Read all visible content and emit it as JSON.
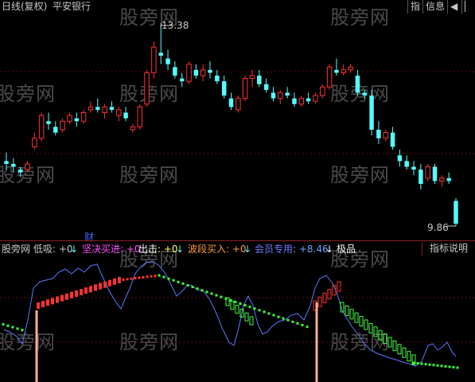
{
  "window": {
    "title_period": "日线(复权)",
    "stock_name": "平安银行",
    "btn_indicator": "指",
    "btn_info": "信息",
    "btn_back": "◀",
    "btn_last": "▏"
  },
  "price_chart": {
    "high_label": "13.38",
    "low_label": "9.86",
    "cai_label": "财",
    "up_color": "#ff3232",
    "down_color": "#54ffff",
    "candles": [
      [
        11.0,
        11.15,
        10.85,
        10.95
      ],
      [
        10.95,
        11.05,
        10.8,
        10.9
      ],
      [
        10.85,
        10.9,
        10.72,
        10.8
      ],
      [
        10.85,
        11.0,
        10.8,
        10.95
      ],
      [
        11.25,
        11.5,
        11.2,
        11.4
      ],
      [
        11.4,
        11.85,
        11.35,
        11.8
      ],
      [
        11.7,
        11.85,
        11.55,
        11.65
      ],
      [
        11.6,
        11.7,
        11.45,
        11.5
      ],
      [
        11.55,
        11.75,
        11.5,
        11.7
      ],
      [
        11.7,
        11.85,
        11.65,
        11.8
      ],
      [
        11.75,
        11.85,
        11.6,
        11.7
      ],
      [
        11.7,
        11.9,
        11.65,
        11.85
      ],
      [
        11.9,
        12.05,
        11.85,
        11.95
      ],
      [
        11.95,
        12.1,
        11.85,
        11.9
      ],
      [
        11.85,
        12.0,
        11.75,
        11.95
      ],
      [
        11.95,
        12.05,
        11.85,
        11.9
      ],
      [
        11.8,
        11.95,
        11.7,
        11.9
      ],
      [
        11.85,
        11.95,
        11.7,
        11.75
      ],
      [
        11.55,
        11.65,
        11.5,
        11.6
      ],
      [
        11.6,
        12.0,
        11.55,
        11.95
      ],
      [
        12.0,
        12.6,
        11.95,
        12.55
      ],
      [
        12.55,
        13.1,
        12.45,
        13.0
      ],
      [
        12.9,
        13.38,
        12.7,
        12.85
      ],
      [
        12.8,
        12.95,
        12.6,
        12.7
      ],
      [
        12.65,
        12.75,
        12.45,
        12.5
      ],
      [
        12.45,
        12.55,
        12.3,
        12.4
      ],
      [
        12.4,
        12.75,
        12.35,
        12.7
      ],
      [
        12.6,
        12.7,
        12.45,
        12.5
      ],
      [
        12.5,
        12.7,
        12.4,
        12.6
      ],
      [
        12.6,
        12.75,
        12.45,
        12.55
      ],
      [
        12.5,
        12.6,
        12.35,
        12.4
      ],
      [
        12.4,
        12.5,
        12.1,
        12.15
      ],
      [
        12.1,
        12.2,
        11.9,
        11.95
      ],
      [
        11.9,
        12.15,
        11.85,
        12.1
      ],
      [
        12.1,
        12.5,
        12.05,
        12.45
      ],
      [
        12.45,
        12.6,
        12.3,
        12.5
      ],
      [
        12.5,
        12.6,
        12.3,
        12.35
      ],
      [
        12.35,
        12.45,
        12.2,
        12.25
      ],
      [
        12.2,
        12.3,
        12.05,
        12.1
      ],
      [
        12.1,
        12.25,
        12.0,
        12.2
      ],
      [
        12.2,
        12.3,
        12.1,
        12.15
      ],
      [
        12.1,
        12.2,
        11.95,
        12.0
      ],
      [
        12.0,
        12.15,
        11.95,
        12.1
      ],
      [
        12.1,
        12.2,
        12.0,
        12.05
      ],
      [
        12.05,
        12.2,
        12.0,
        12.15
      ],
      [
        12.15,
        12.35,
        12.1,
        12.3
      ],
      [
        12.3,
        12.7,
        12.25,
        12.65
      ],
      [
        12.6,
        12.8,
        12.5,
        12.55
      ],
      [
        12.55,
        12.7,
        12.5,
        12.6
      ],
      [
        12.6,
        12.7,
        12.55,
        12.65
      ],
      [
        12.5,
        12.6,
        12.15,
        12.2
      ],
      [
        12.2,
        12.25,
        12.1,
        12.15
      ],
      [
        12.15,
        12.25,
        11.45,
        11.55
      ],
      [
        11.55,
        11.7,
        11.3,
        11.4
      ],
      [
        11.4,
        11.55,
        11.35,
        11.5
      ],
      [
        11.5,
        11.6,
        11.2,
        11.25
      ],
      [
        11.1,
        11.2,
        10.9,
        11.0
      ],
      [
        11.0,
        11.1,
        10.85,
        10.9
      ],
      [
        10.9,
        11.0,
        10.75,
        10.85
      ],
      [
        10.85,
        10.95,
        10.5,
        10.6
      ],
      [
        10.7,
        10.95,
        10.65,
        10.9
      ],
      [
        10.9,
        10.95,
        10.6,
        10.65
      ],
      [
        10.65,
        10.75,
        10.55,
        10.7
      ],
      [
        10.7,
        10.8,
        10.6,
        10.65
      ],
      [
        10.3,
        10.35,
        9.86,
        9.9
      ]
    ]
  },
  "indicator": {
    "name": "股旁网 低吸",
    "v1": ": +0",
    "l2": "坚决买进",
    "v2": ": +0",
    "l3": "出击",
    "v3": ": +0",
    "l4": "波段买入",
    "v4": ": +0",
    "l5": "会员专用",
    "v5": ": +8.46",
    "l6": "极品",
    "explain_btn": "指标说明",
    "line_color": "#5a78ff",
    "red_color": "#ff3232",
    "green_color": "#3cff3c",
    "peach_color": "#ffb090"
  },
  "watermark": "股旁网"
}
